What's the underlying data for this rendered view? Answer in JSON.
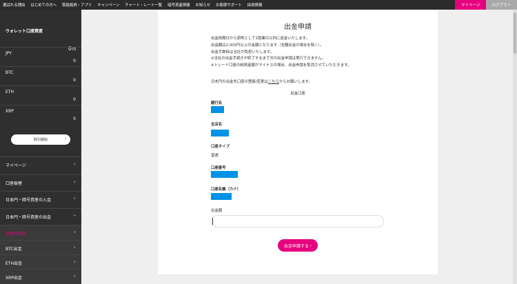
{
  "nav": {
    "links": [
      "選ばれる理由",
      "はじめての方へ",
      "取扱銘柄・アプリ",
      "キャンペーン",
      "チャート・レート一覧",
      "暗号資産情報",
      "お知らせ",
      "お客様サポート",
      "採用情報"
    ],
    "mypage": "マイページ",
    "logout": "ログアウト"
  },
  "sidebar": {
    "wallet_title": "ウォレット口座資産",
    "wallet_total": "0",
    "wallet_unit": "円",
    "balances": [
      {
        "currency": "JPY",
        "amount": "0"
      },
      {
        "currency": "BTC",
        "amount": "0"
      },
      {
        "currency": "ETH",
        "amount": "0"
      },
      {
        "currency": "XRP",
        "amount": "0"
      }
    ],
    "trade_button": "取引開始",
    "menu": [
      {
        "label": "マイページ",
        "chevron": "›"
      },
      {
        "label": "口座振替",
        "chevron": "›"
      },
      {
        "label": "日本円・暗号資産の入金",
        "chevron": "›"
      },
      {
        "label": "日本円・暗号資産の出金",
        "chevron": "‹"
      },
      {
        "label": "日本円出金",
        "chevron": "›"
      },
      {
        "label": "BTC出金",
        "chevron": "›"
      },
      {
        "label": "ETH出金",
        "chevron": "›"
      },
      {
        "label": "XRP出金",
        "chevron": "›"
      }
    ]
  },
  "main": {
    "title": "出金申請",
    "notes": [
      "出金依頼日から原則として3営業日以内に送金いたします。",
      "出金額は2,000円以上の金額となります（全額出金の場合を除く）。",
      "出金手数料は当社が負担いたします。",
      "※当社の出金手続きが終了するまで次の出金申請は実行できません。",
      "※トレード口座の純資産額がマイナスの場合、出金申請を取消させていただきます。"
    ],
    "reg_note_before": "日本円の出金先口座の登録/変更は",
    "reg_note_link": "こちら",
    "reg_note_after": "からお願いします。",
    "account_heading": "出金口座",
    "fields": {
      "bank_label": "銀行名",
      "branch_label": "支店名",
      "type_label": "口座タイプ",
      "type_value": "普通",
      "number_label": "口座番号",
      "holder_label": "口座名義（カナ）"
    },
    "amount_label": "出金額",
    "amount_value": "",
    "submit_label": "出金申請する",
    "submit_chevron": "›"
  },
  "colors": {
    "accent": "#e6007e",
    "redaction": "#0092e6",
    "sidebar_bg": "#2f2f2f"
  }
}
